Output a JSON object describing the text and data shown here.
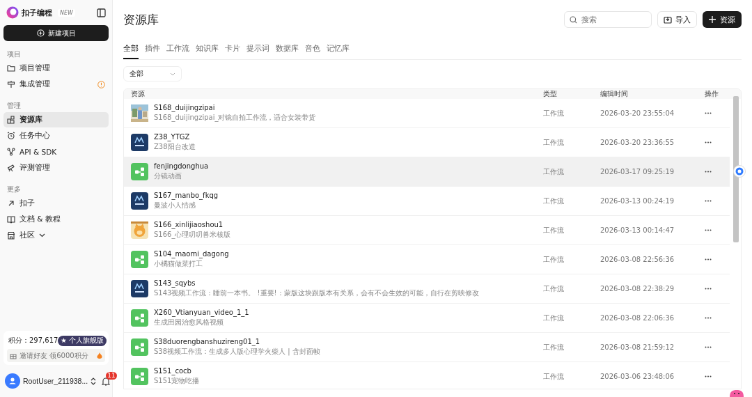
{
  "sidebar": {
    "brand": "扣子编程",
    "badge": "NEW",
    "new_button": "新建项目",
    "sections": [
      {
        "title": "项目",
        "items": [
          {
            "label": "项目管理",
            "selected": false
          },
          {
            "label": "集成管理",
            "selected": false,
            "alert": true
          }
        ]
      },
      {
        "title": "管理",
        "items": [
          {
            "label": "资源库",
            "selected": true
          },
          {
            "label": "任务中心",
            "selected": false
          },
          {
            "label": "API & SDK",
            "selected": false
          },
          {
            "label": "评测管理",
            "selected": false
          }
        ]
      },
      {
        "title": "更多",
        "items": [
          {
            "label": "扣子",
            "selected": false
          },
          {
            "label": "文档 & 教程",
            "selected": false
          },
          {
            "label": "社区",
            "selected": false,
            "dropdown": true
          }
        ]
      }
    ],
    "points": {
      "label": "积分：297,617",
      "plan": "★ 个人旗舰版",
      "invite": "邀请好友 领6000积分"
    },
    "user": {
      "name": "RootUser_211938...",
      "notifications": "11"
    }
  },
  "page": {
    "title": "资源库",
    "search": {
      "placeholder": "搜索"
    },
    "import_button": "导入",
    "add_button": "资源",
    "tabs": [
      {
        "label": "全部",
        "selected": true
      },
      {
        "label": "插件",
        "selected": false
      },
      {
        "label": "工作流",
        "selected": false
      },
      {
        "label": "知识库",
        "selected": false
      },
      {
        "label": "卡片",
        "selected": false
      },
      {
        "label": "提示词",
        "selected": false
      },
      {
        "label": "数据库",
        "selected": false
      },
      {
        "label": "音色",
        "selected": false
      },
      {
        "label": "记忆库",
        "selected": false
      }
    ],
    "filter": "全部",
    "table": {
      "columns": [
        "资源",
        "类型",
        "编辑时间",
        "操作"
      ],
      "rows": [
        {
          "kind": "picture",
          "name": "S168_duijingzipai",
          "desc": "S168_duijingzipai_对镜自拍工作流，适合女装带货",
          "type": "工作流",
          "time": "2026-03-20 23:55:04",
          "selected": false
        },
        {
          "kind": "app",
          "name": "Z38_YTGZ",
          "desc": "Z38阳台改造",
          "type": "工作流",
          "time": "2026-03-20 23:36:55",
          "selected": false
        },
        {
          "kind": "workflow",
          "name": "fenjingdonghua",
          "desc": "分镜动画",
          "type": "工作流",
          "time": "2026-03-17 09:25:19",
          "selected": true
        },
        {
          "kind": "app",
          "name": "S167_manbo_fkqg",
          "desc": "曼波小人情感",
          "type": "工作流",
          "time": "2026-03-13 00:24:19",
          "selected": false
        },
        {
          "kind": "mascot",
          "name": "S166_xinlijiaoshou1",
          "desc": "S166_心理叨叨兽米核版",
          "type": "工作流",
          "time": "2026-03-13 00:14:47",
          "selected": false
        },
        {
          "kind": "workflow",
          "name": "S104_maomi_dagong",
          "desc": "小橘猫做菜打工",
          "type": "工作流",
          "time": "2026-03-08 22:56:36",
          "selected": false
        },
        {
          "kind": "app",
          "name": "S143_sqybs",
          "desc": "S143视频工作流：睡前一本书。 !重要!：蒙版这块跟版本有关系，会有不会生效的可能，自行在剪映修改",
          "type": "工作流",
          "time": "2026-03-08 22:38:29",
          "selected": false
        },
        {
          "kind": "workflow",
          "name": "X260_Vtianyuan_video_1_1",
          "desc": "生成田园治愈风格视频",
          "type": "工作流",
          "time": "2026-03-08 22:06:36",
          "selected": false
        },
        {
          "kind": "workflow",
          "name": "S38duorengbanshuzireng01_1",
          "desc": "S38视频工作流：生成多人版心理学火柴人 | 含封面帧",
          "type": "工作流",
          "time": "2026-03-08 21:59:12",
          "selected": false
        },
        {
          "kind": "workflow",
          "name": "S151_cocb",
          "desc": "S151宠物吃播",
          "type": "工作流",
          "time": "2026-03-06 23:48:06",
          "selected": false
        }
      ]
    }
  }
}
